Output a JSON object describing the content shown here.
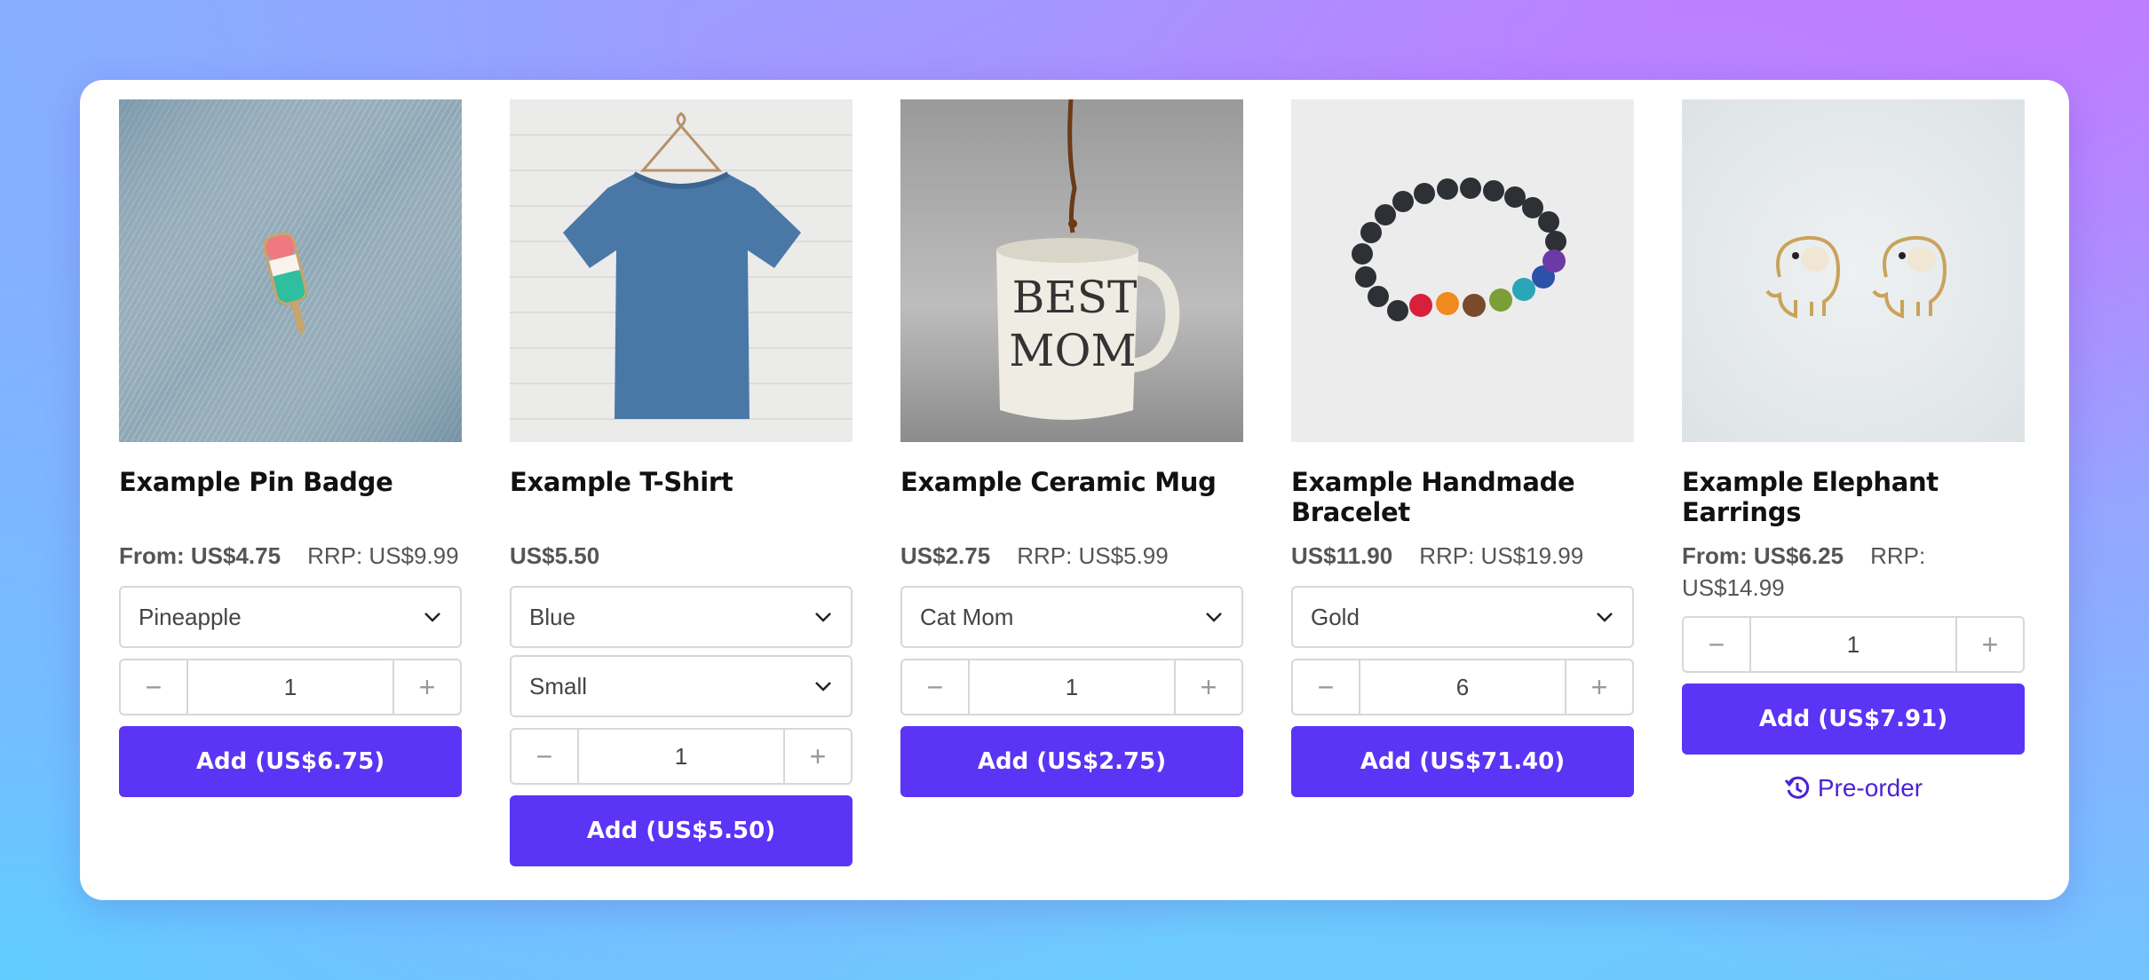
{
  "products": [
    {
      "title": "Example Pin Badge",
      "price": "From: US$4.75",
      "rrp": "RRP: US$9.99",
      "variant": "Pineapple",
      "quantity": "1",
      "add_label": "Add (US$6.75)",
      "image": "pin-badge-photo"
    },
    {
      "title": "Example T-Shirt",
      "price": "US$5.50",
      "rrp": "",
      "variant": "Blue",
      "size": "Small",
      "quantity": "1",
      "add_label": "Add (US$5.50)",
      "image": "t-shirt-photo"
    },
    {
      "title": "Example Ceramic Mug",
      "price": "US$2.75",
      "rrp": "RRP: US$5.99",
      "variant": "Cat Mom",
      "quantity": "1",
      "add_label": "Add (US$2.75)",
      "image": "mug-photo",
      "image_text_1": "BEST",
      "image_text_2": "MOM"
    },
    {
      "title": "Example Handmade Bracelet",
      "price": "US$11.90",
      "rrp": "RRP: US$19.99",
      "variant": "Gold",
      "quantity": "6",
      "add_label": "Add (US$71.40)",
      "image": "bracelet-photo"
    },
    {
      "title": "Example Elephant Earrings",
      "price": "From: US$6.25",
      "rrp": "RRP:",
      "rrp_line2": "US$14.99",
      "quantity": "1",
      "add_label": "Add (US$7.91)",
      "preorder_label": "Pre-order",
      "image": "earrings-photo"
    }
  ],
  "icons": {
    "minus": "−",
    "plus": "+"
  },
  "colors": {
    "accent": "#5b34f5",
    "preorder": "#4a22d8"
  }
}
